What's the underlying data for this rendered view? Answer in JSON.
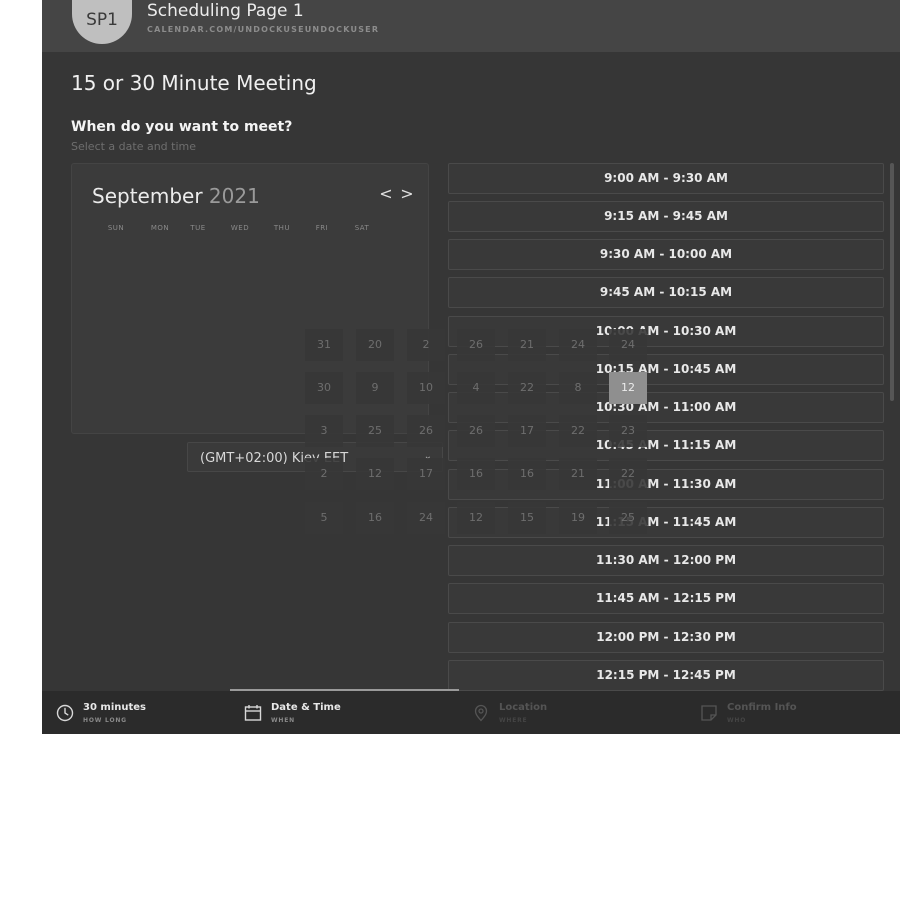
{
  "header": {
    "avatar_initials": "SP1",
    "page_name": "Scheduling Page 1",
    "page_url": "CALENDAR.COM/UNDOCKUSEUNDOCKUSER"
  },
  "meeting": {
    "title": "15 or 30 Minute Meeting",
    "question": "When do you want to meet?",
    "hint": "Select a date and time"
  },
  "calendar": {
    "month": "September",
    "year": "2021",
    "prev_icon": "<",
    "next_icon": ">",
    "weekdays": [
      "SUN",
      "MON",
      "TUE",
      "WED",
      "THU",
      "FRI",
      "SAT"
    ],
    "date_cells": [
      "31",
      "20",
      "2",
      "26",
      "21",
      "24",
      "24",
      "30",
      "9",
      "10",
      "4",
      "22",
      "8",
      "12",
      "3",
      "25",
      "26",
      "26",
      "17",
      "22",
      "23",
      "2",
      "12",
      "17",
      "16",
      "16",
      "21",
      "22",
      "5",
      "16",
      "24",
      "12",
      "15",
      "19",
      "25"
    ],
    "selected_date": "12"
  },
  "timezone": {
    "value": "(GMT+02:00) Kiev EET",
    "caret_icon": "chevron-down-icon"
  },
  "time_slots": [
    "9:00 AM - 9:30 AM",
    "9:15 AM - 9:45 AM",
    "9:30 AM - 10:00 AM",
    "9:45 AM - 10:15 AM",
    "10:00 AM - 10:30 AM",
    "10:15 AM - 10:45 AM",
    "10:30 AM - 11:00 AM",
    "10:45 AM - 11:15 AM",
    "11:00 AM - 11:30 AM",
    "11:15 AM - 11:45 AM",
    "11:30 AM - 12:00 PM",
    "11:45 AM - 12:15 PM",
    "12:00 PM - 12:30 PM",
    "12:15 PM - 12:45 PM"
  ],
  "footer": {
    "steps": [
      {
        "label": "30 minutes",
        "sub": "HOW LONG",
        "icon": "clock-icon"
      },
      {
        "label": "Date & Time",
        "sub": "WHEN",
        "icon": "calendar-icon"
      },
      {
        "label": "Location",
        "sub": "WHERE",
        "icon": "location-pin-icon"
      },
      {
        "label": "Confirm Info",
        "sub": "WHO",
        "icon": "note-icon"
      }
    ]
  },
  "colors": {
    "background": "#363636",
    "header": "#454545",
    "footer": "#2b2b2b",
    "text": "#e8e8e8",
    "selected_date": "#8f8f8f"
  }
}
